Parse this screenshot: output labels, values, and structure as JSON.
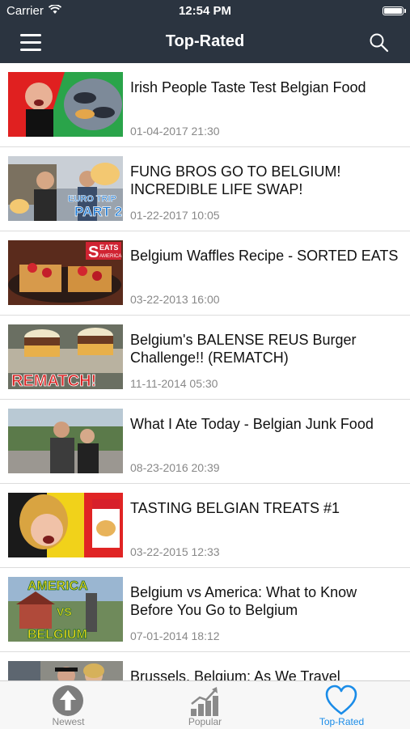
{
  "status": {
    "carrier": "Carrier",
    "time": "12:54 PM"
  },
  "nav": {
    "title": "Top-Rated"
  },
  "videos": [
    {
      "title": "Irish People Taste Test Belgian Food",
      "date": "01-04-2017 21:30"
    },
    {
      "title": "FUNG BROS GO TO BELGIUM! INCREDIBLE LIFE SWAP!",
      "date": "01-22-2017 10:05",
      "thumb_text": [
        "EURO TRIP",
        "PART 2!"
      ]
    },
    {
      "title": "Belgium Waffles Recipe - SORTED EATS",
      "date": "03-22-2013 16:00",
      "thumb_text": [
        "S",
        "EATS",
        "AMERICA"
      ]
    },
    {
      "title": "Belgium's BALENSE REUS Burger Challenge!! (REMATCH)",
      "date": "11-11-2014 05:30",
      "thumb_text": [
        "REMATCH!"
      ]
    },
    {
      "title": "What I Ate Today - Belgian Junk Food",
      "date": "08-23-2016 20:39"
    },
    {
      "title": "TASTING BELGIAN TREATS #1",
      "date": "03-22-2015 12:33"
    },
    {
      "title": "Belgium vs America: What to Know Before You Go to Belgium",
      "date": "07-01-2014 18:12",
      "thumb_text": [
        "AMERICA",
        "VS",
        "BELGIUM"
      ]
    },
    {
      "title": "Brussels, Belgium: As We Travel",
      "date": ""
    }
  ],
  "tabs": [
    {
      "label": "Newest",
      "icon": "up-arrow-circle-icon"
    },
    {
      "label": "Popular",
      "icon": "bar-chart-trend-icon"
    },
    {
      "label": "Top-Rated",
      "icon": "heart-icon",
      "active": true
    }
  ],
  "colors": {
    "bar": "#2b3440",
    "accent": "#1a8ce8"
  }
}
